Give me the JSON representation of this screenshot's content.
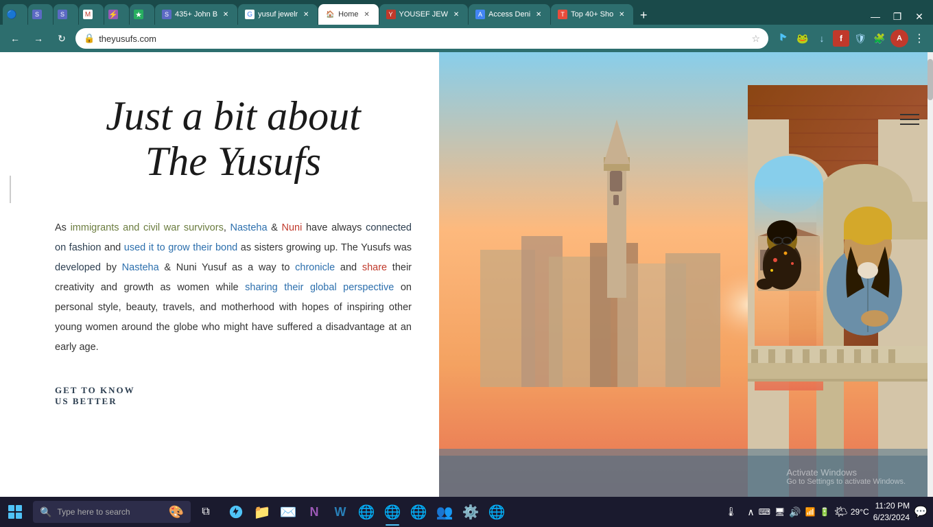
{
  "browser": {
    "tabs": [
      {
        "id": "tab1",
        "label": "",
        "favicon": "●",
        "active": false,
        "icon_color": "#2d6e6e"
      },
      {
        "id": "tab2",
        "label": "",
        "favicon": "S",
        "active": false,
        "icon_color": "#5c6ac4"
      },
      {
        "id": "tab3",
        "label": "",
        "favicon": "S",
        "active": false,
        "icon_color": "#5c6ac4"
      },
      {
        "id": "tab4",
        "label": "",
        "favicon": "M",
        "active": false,
        "icon_color": "#c0392b"
      },
      {
        "id": "tab5",
        "label": "",
        "favicon": "⚡",
        "active": false,
        "icon_color": "#9b59b6"
      },
      {
        "id": "tab6",
        "label": "",
        "favicon": "★",
        "active": false,
        "icon_color": "#f39c12"
      },
      {
        "id": "tab7",
        "label": "435+ John B",
        "favicon": "S",
        "active": false,
        "icon_color": "#5c6ac4"
      },
      {
        "id": "tab8",
        "label": "yusuf jewelr",
        "favicon": "G",
        "active": false,
        "icon_color": "#4285f4"
      },
      {
        "id": "tab9",
        "label": "Home",
        "favicon": "H",
        "active": true,
        "icon_color": "#2c6fad"
      },
      {
        "id": "tab10",
        "label": "YOUSEF JEW",
        "favicon": "Y",
        "active": false,
        "icon_color": "#c0392b"
      },
      {
        "id": "tab11",
        "label": "Access Deni",
        "favicon": "A",
        "active": false,
        "icon_color": "#4285f4"
      },
      {
        "id": "tab12",
        "label": "Top 40+ Sho",
        "favicon": "T",
        "active": false,
        "icon_color": "#e74c3c"
      }
    ],
    "url": "theyusufs.com",
    "window_controls": [
      "—",
      "❐",
      "✕"
    ]
  },
  "page": {
    "heading_line1": "Just a bit about",
    "heading_line2": "The Yusufs",
    "body_text": "As immigrants and civil war survivors, Nasteha & Nuni have always connected on fashion and used it to grow their bond as sisters growing up. The Yusufs was developed by Nasteha & Nuni Yusuf as a way to chronicle and share their creativity and growth as women while sharing their global perspective on personal style, beauty, travels, and motherhood with hopes of inspiring other young women around the globe who might have suffered a disadvantage at an early age.",
    "cta_line1": "GET TO KNOW",
    "cta_line2": "US BETTER",
    "menu_label": "Menu"
  },
  "activate_windows": {
    "line1": "Activate Windows",
    "line2": "Go to Settings to activate Windows."
  },
  "taskbar": {
    "search_placeholder": "Type here to search",
    "time": "11:20 PM",
    "date": "6/23/2024",
    "temperature": "29°C",
    "icons": [
      "taskview",
      "edge",
      "file-explorer",
      "mail",
      "onenote",
      "word",
      "chrome-work",
      "chrome",
      "chrome-alt",
      "teams",
      "chrome-ext",
      "chrome-2",
      "settings"
    ],
    "system_icons": [
      "chevron-up",
      "keyboard",
      "display",
      "volume",
      "network",
      "battery",
      "notification"
    ]
  }
}
